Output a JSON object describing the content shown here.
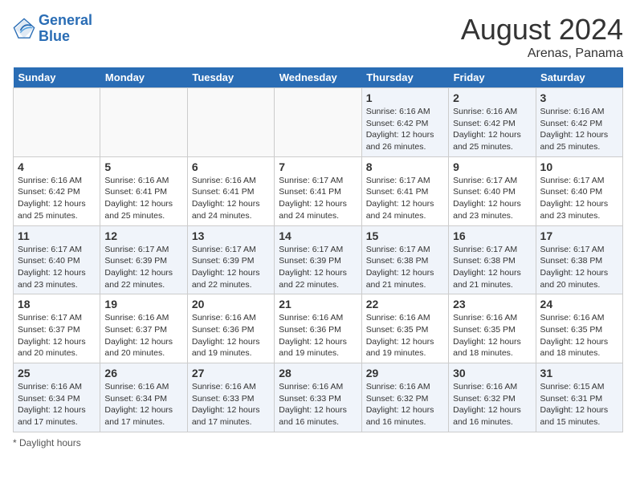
{
  "header": {
    "logo_line1": "General",
    "logo_line2": "Blue",
    "month_year": "August 2024",
    "location": "Arenas, Panama"
  },
  "day_headers": [
    "Sunday",
    "Monday",
    "Tuesday",
    "Wednesday",
    "Thursday",
    "Friday",
    "Saturday"
  ],
  "weeks": [
    [
      {
        "day": "",
        "info": ""
      },
      {
        "day": "",
        "info": ""
      },
      {
        "day": "",
        "info": ""
      },
      {
        "day": "",
        "info": ""
      },
      {
        "day": "1",
        "info": "Sunrise: 6:16 AM\nSunset: 6:42 PM\nDaylight: 12 hours\nand 26 minutes."
      },
      {
        "day": "2",
        "info": "Sunrise: 6:16 AM\nSunset: 6:42 PM\nDaylight: 12 hours\nand 25 minutes."
      },
      {
        "day": "3",
        "info": "Sunrise: 6:16 AM\nSunset: 6:42 PM\nDaylight: 12 hours\nand 25 minutes."
      }
    ],
    [
      {
        "day": "4",
        "info": "Sunrise: 6:16 AM\nSunset: 6:42 PM\nDaylight: 12 hours\nand 25 minutes."
      },
      {
        "day": "5",
        "info": "Sunrise: 6:16 AM\nSunset: 6:41 PM\nDaylight: 12 hours\nand 25 minutes."
      },
      {
        "day": "6",
        "info": "Sunrise: 6:16 AM\nSunset: 6:41 PM\nDaylight: 12 hours\nand 24 minutes."
      },
      {
        "day": "7",
        "info": "Sunrise: 6:17 AM\nSunset: 6:41 PM\nDaylight: 12 hours\nand 24 minutes."
      },
      {
        "day": "8",
        "info": "Sunrise: 6:17 AM\nSunset: 6:41 PM\nDaylight: 12 hours\nand 24 minutes."
      },
      {
        "day": "9",
        "info": "Sunrise: 6:17 AM\nSunset: 6:40 PM\nDaylight: 12 hours\nand 23 minutes."
      },
      {
        "day": "10",
        "info": "Sunrise: 6:17 AM\nSunset: 6:40 PM\nDaylight: 12 hours\nand 23 minutes."
      }
    ],
    [
      {
        "day": "11",
        "info": "Sunrise: 6:17 AM\nSunset: 6:40 PM\nDaylight: 12 hours\nand 23 minutes."
      },
      {
        "day": "12",
        "info": "Sunrise: 6:17 AM\nSunset: 6:39 PM\nDaylight: 12 hours\nand 22 minutes."
      },
      {
        "day": "13",
        "info": "Sunrise: 6:17 AM\nSunset: 6:39 PM\nDaylight: 12 hours\nand 22 minutes."
      },
      {
        "day": "14",
        "info": "Sunrise: 6:17 AM\nSunset: 6:39 PM\nDaylight: 12 hours\nand 22 minutes."
      },
      {
        "day": "15",
        "info": "Sunrise: 6:17 AM\nSunset: 6:38 PM\nDaylight: 12 hours\nand 21 minutes."
      },
      {
        "day": "16",
        "info": "Sunrise: 6:17 AM\nSunset: 6:38 PM\nDaylight: 12 hours\nand 21 minutes."
      },
      {
        "day": "17",
        "info": "Sunrise: 6:17 AM\nSunset: 6:38 PM\nDaylight: 12 hours\nand 20 minutes."
      }
    ],
    [
      {
        "day": "18",
        "info": "Sunrise: 6:17 AM\nSunset: 6:37 PM\nDaylight: 12 hours\nand 20 minutes."
      },
      {
        "day": "19",
        "info": "Sunrise: 6:16 AM\nSunset: 6:37 PM\nDaylight: 12 hours\nand 20 minutes."
      },
      {
        "day": "20",
        "info": "Sunrise: 6:16 AM\nSunset: 6:36 PM\nDaylight: 12 hours\nand 19 minutes."
      },
      {
        "day": "21",
        "info": "Sunrise: 6:16 AM\nSunset: 6:36 PM\nDaylight: 12 hours\nand 19 minutes."
      },
      {
        "day": "22",
        "info": "Sunrise: 6:16 AM\nSunset: 6:35 PM\nDaylight: 12 hours\nand 19 minutes."
      },
      {
        "day": "23",
        "info": "Sunrise: 6:16 AM\nSunset: 6:35 PM\nDaylight: 12 hours\nand 18 minutes."
      },
      {
        "day": "24",
        "info": "Sunrise: 6:16 AM\nSunset: 6:35 PM\nDaylight: 12 hours\nand 18 minutes."
      }
    ],
    [
      {
        "day": "25",
        "info": "Sunrise: 6:16 AM\nSunset: 6:34 PM\nDaylight: 12 hours\nand 17 minutes."
      },
      {
        "day": "26",
        "info": "Sunrise: 6:16 AM\nSunset: 6:34 PM\nDaylight: 12 hours\nand 17 minutes."
      },
      {
        "day": "27",
        "info": "Sunrise: 6:16 AM\nSunset: 6:33 PM\nDaylight: 12 hours\nand 17 minutes."
      },
      {
        "day": "28",
        "info": "Sunrise: 6:16 AM\nSunset: 6:33 PM\nDaylight: 12 hours\nand 16 minutes."
      },
      {
        "day": "29",
        "info": "Sunrise: 6:16 AM\nSunset: 6:32 PM\nDaylight: 12 hours\nand 16 minutes."
      },
      {
        "day": "30",
        "info": "Sunrise: 6:16 AM\nSunset: 6:32 PM\nDaylight: 12 hours\nand 16 minutes."
      },
      {
        "day": "31",
        "info": "Sunrise: 6:15 AM\nSunset: 6:31 PM\nDaylight: 12 hours\nand 15 minutes."
      }
    ]
  ],
  "footer": "Daylight hours"
}
